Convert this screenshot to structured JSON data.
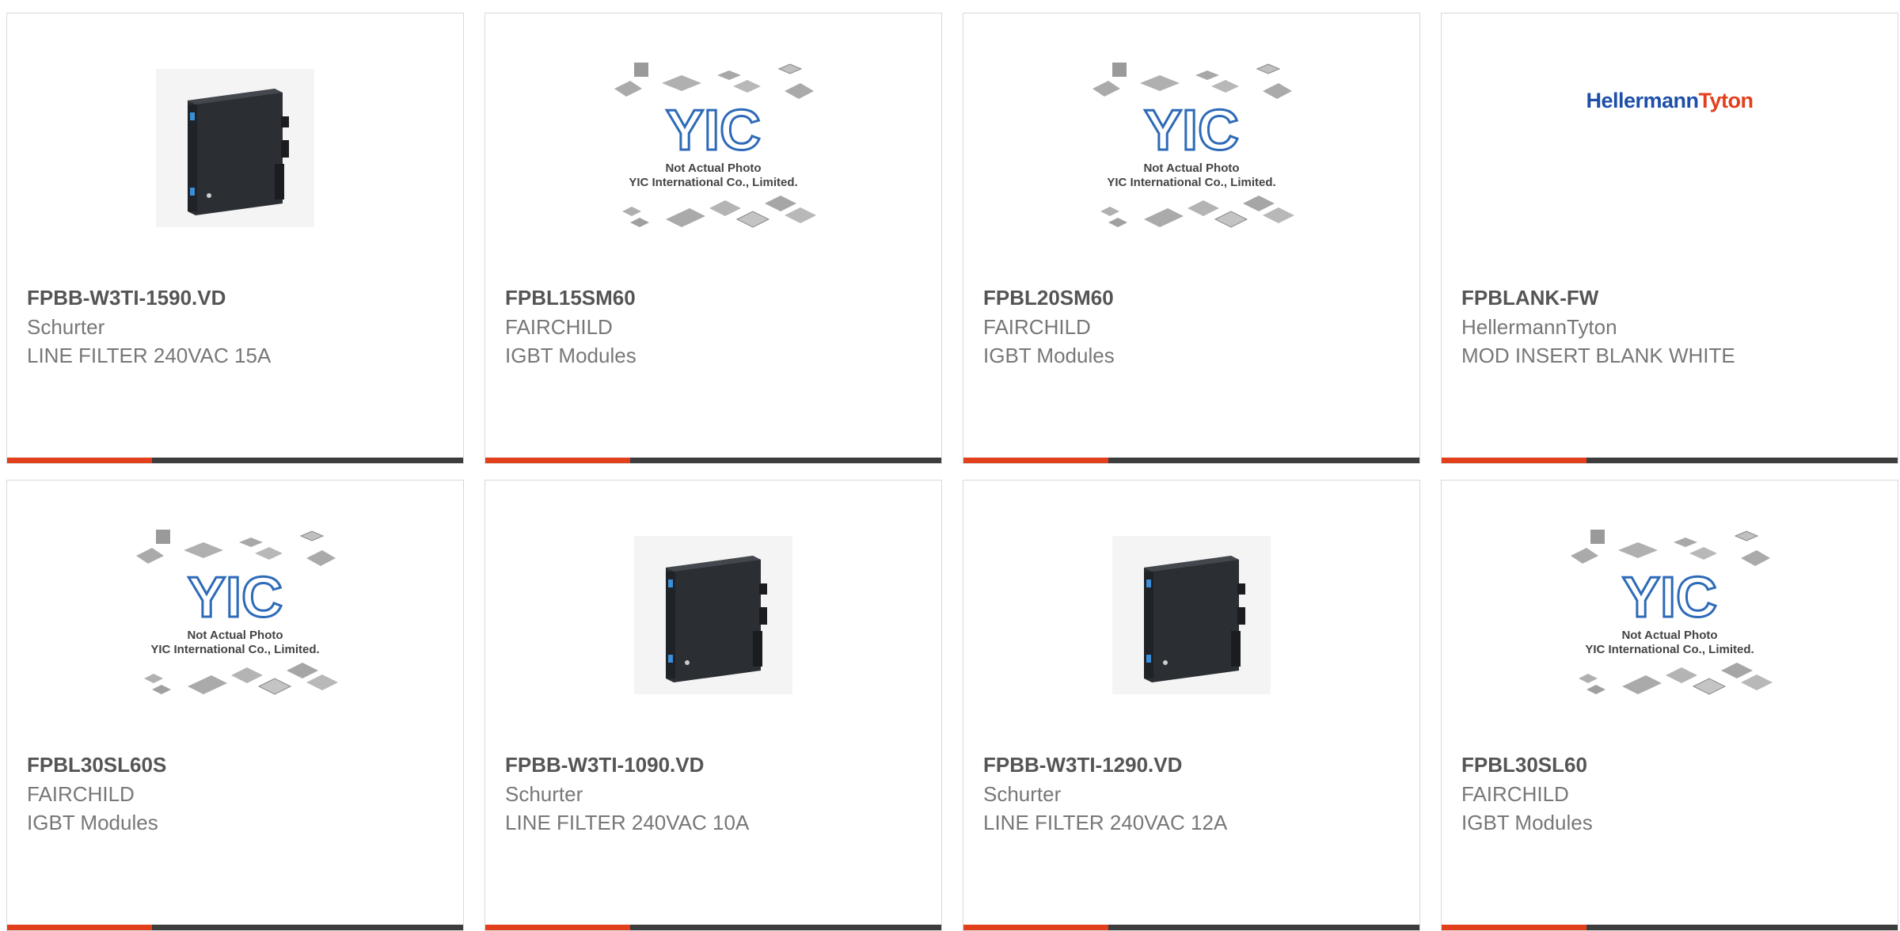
{
  "colors": {
    "accent": "#e2401c",
    "bar": "#3d3d3d",
    "yic_blue": "#2d6ab8"
  },
  "placeholder": {
    "line1": "Not Actual Photo",
    "line2": "YIC International Co., Limited.",
    "logo_text": "YIC"
  },
  "hellermann_logo": {
    "part1": "Hellermann",
    "part2": "Tyton"
  },
  "products": [
    {
      "part": "FPBB-W3TI-1590.VD",
      "manufacturer": "Schurter",
      "description": "LINE FILTER 240VAC 15A",
      "image": "line-filter-photo"
    },
    {
      "part": "FPBL15SM60",
      "manufacturer": "FAIRCHILD",
      "description": "IGBT Modules",
      "image": "not-actual-photo-placeholder"
    },
    {
      "part": "FPBL20SM60",
      "manufacturer": "FAIRCHILD",
      "description": "IGBT Modules",
      "image": "not-actual-photo-placeholder"
    },
    {
      "part": "FPBLANK-FW",
      "manufacturer": "HellermannTyton",
      "description": "MOD INSERT BLANK WHITE",
      "image": "hellermanntyton-logo"
    },
    {
      "part": "FPBL30SL60S",
      "manufacturer": "FAIRCHILD",
      "description": "IGBT Modules",
      "image": "not-actual-photo-placeholder"
    },
    {
      "part": "FPBB-W3TI-1090.VD",
      "manufacturer": "Schurter",
      "description": "LINE FILTER 240VAC 10A",
      "image": "line-filter-photo"
    },
    {
      "part": "FPBB-W3TI-1290.VD",
      "manufacturer": "Schurter",
      "description": "LINE FILTER 240VAC 12A",
      "image": "line-filter-photo"
    },
    {
      "part": "FPBL30SL60",
      "manufacturer": "FAIRCHILD",
      "description": "IGBT Modules",
      "image": "not-actual-photo-placeholder"
    }
  ]
}
